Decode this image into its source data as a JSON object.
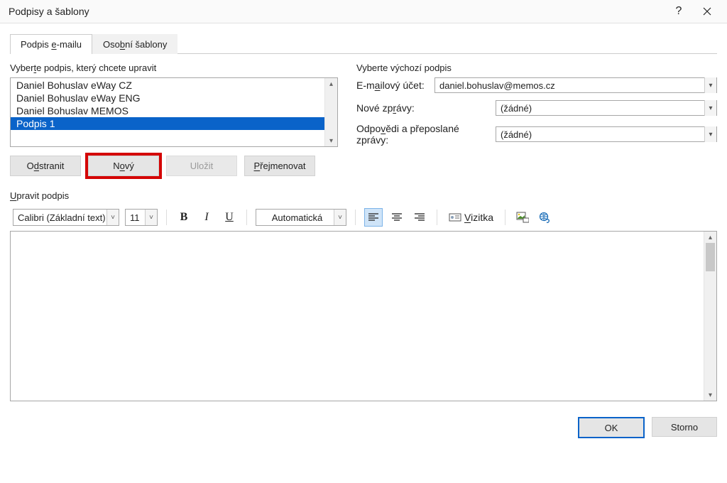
{
  "title": "Podpisy a šablony",
  "tabs": {
    "email_pre": "Podpis ",
    "email_u": "e",
    "email_post": "-mailu",
    "personal_pre": "Oso",
    "personal_u": "b",
    "personal_post": "ní šablony"
  },
  "left": {
    "label_pre": "Vyber",
    "label_u": "t",
    "label_post": "e podpis, který chcete upravit",
    "items": [
      "Daniel Bohuslav eWay CZ",
      "Daniel Bohuslav eWay ENG",
      "Daniel Bohuslav MEMOS",
      "Podpis 1"
    ],
    "buttons": {
      "delete_pre": "O",
      "delete_u": "d",
      "delete_post": "stranit",
      "new_pre": "N",
      "new_u": "o",
      "new_post": "vý",
      "save": "Uložit",
      "rename_u": "P",
      "rename_post": "řejmenovat"
    }
  },
  "right": {
    "title": "Vyberte výchozí podpis",
    "account_label_pre": "E-m",
    "account_label_u": "a",
    "account_label_post": "ilový účet:",
    "account_value": "daniel.bohuslav@memos.cz",
    "newmsg_label_pre": "Nové zp",
    "newmsg_label_u": "r",
    "newmsg_label_post": "ávy:",
    "newmsg_value": "(žádné)",
    "reply_label_pre": "Odpo",
    "reply_label_u": "v",
    "reply_label_post": "ědi a přeposlané zprávy:",
    "reply_value": "(žádné)"
  },
  "edit": {
    "label_u": "U",
    "label_post": "pravit podpis",
    "font": "Calibri (Základní text)",
    "size": "11",
    "color": "Automatická",
    "vizitka_u": "V",
    "vizitka_post": "izitka"
  },
  "footer": {
    "ok": "OK",
    "cancel": "Storno"
  }
}
